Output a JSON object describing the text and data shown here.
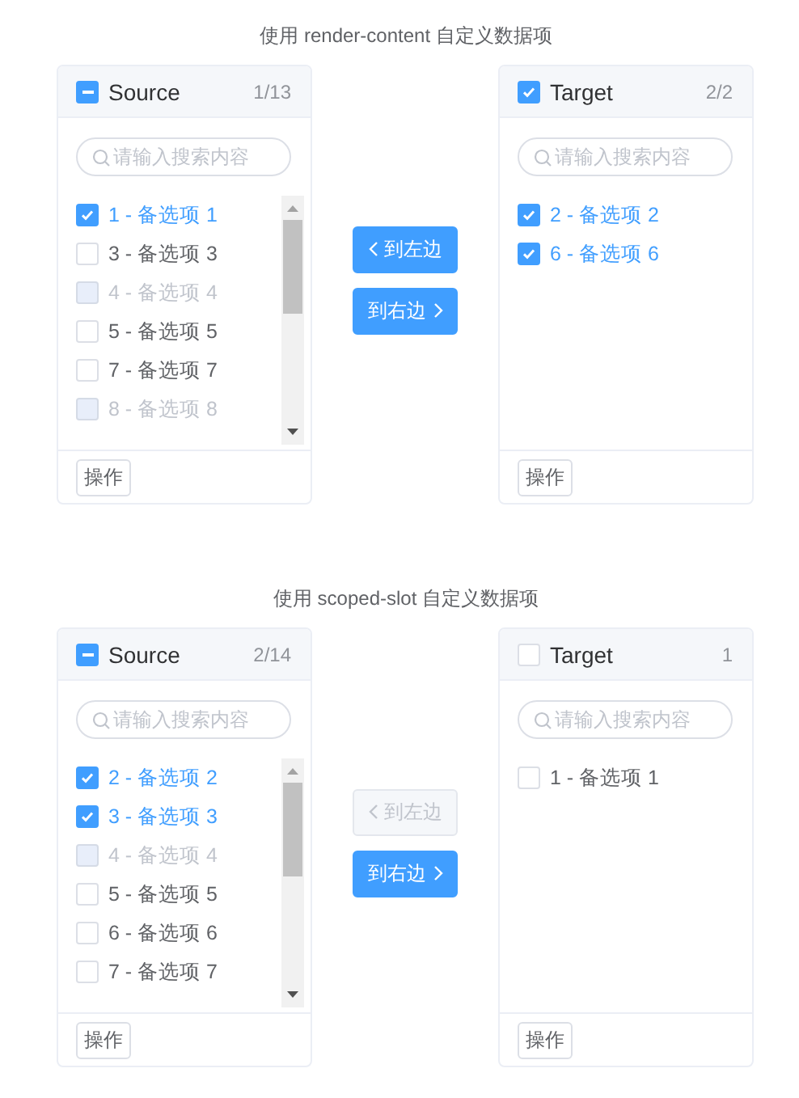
{
  "demos": [
    {
      "title": "使用 render-content 自定义数据项",
      "source": {
        "title": "Source",
        "count": "1/13",
        "checked": false,
        "indeterminate": true,
        "placeholder": "请输入搜索内容",
        "footer_button": "操作",
        "items": [
          {
            "label": "1 - 备选项 1",
            "checked": true,
            "disabled": false
          },
          {
            "label": "3 - 备选项 3",
            "checked": false,
            "disabled": false
          },
          {
            "label": "4 - 备选项 4",
            "checked": false,
            "disabled": true
          },
          {
            "label": "5 - 备选项 5",
            "checked": false,
            "disabled": false
          },
          {
            "label": "7 - 备选项 7",
            "checked": false,
            "disabled": false
          },
          {
            "label": "8 - 备选项 8",
            "checked": false,
            "disabled": true
          }
        ]
      },
      "buttons": [
        {
          "label": "到左边",
          "kind": "left",
          "disabled": false
        },
        {
          "label": "到右边",
          "kind": "right",
          "disabled": false
        }
      ],
      "target": {
        "title": "Target",
        "count": "2/2",
        "checked": true,
        "indeterminate": false,
        "placeholder": "请输入搜索内容",
        "footer_button": "操作",
        "items": [
          {
            "label": "2 - 备选项 2",
            "checked": true,
            "disabled": false
          },
          {
            "label": "6 - 备选项 6",
            "checked": true,
            "disabled": false
          }
        ]
      }
    },
    {
      "title": "使用 scoped-slot 自定义数据项",
      "source": {
        "title": "Source",
        "count": "2/14",
        "checked": false,
        "indeterminate": true,
        "placeholder": "请输入搜索内容",
        "footer_button": "操作",
        "items": [
          {
            "label": "2 - 备选项 2",
            "checked": true,
            "disabled": false
          },
          {
            "label": "3 - 备选项 3",
            "checked": true,
            "disabled": false
          },
          {
            "label": "4 - 备选项 4",
            "checked": false,
            "disabled": true
          },
          {
            "label": "5 - 备选项 5",
            "checked": false,
            "disabled": false
          },
          {
            "label": "6 - 备选项 6",
            "checked": false,
            "disabled": false
          },
          {
            "label": "7 - 备选项 7",
            "checked": false,
            "disabled": false
          }
        ]
      },
      "buttons": [
        {
          "label": "到左边",
          "kind": "left",
          "disabled": true
        },
        {
          "label": "到右边",
          "kind": "right",
          "disabled": false
        }
      ],
      "target": {
        "title": "Target",
        "count": "1",
        "checked": false,
        "indeterminate": false,
        "placeholder": "请输入搜索内容",
        "footer_button": "操作",
        "items": [
          {
            "label": "1 - 备选项 1",
            "checked": false,
            "disabled": false
          }
        ]
      }
    }
  ]
}
